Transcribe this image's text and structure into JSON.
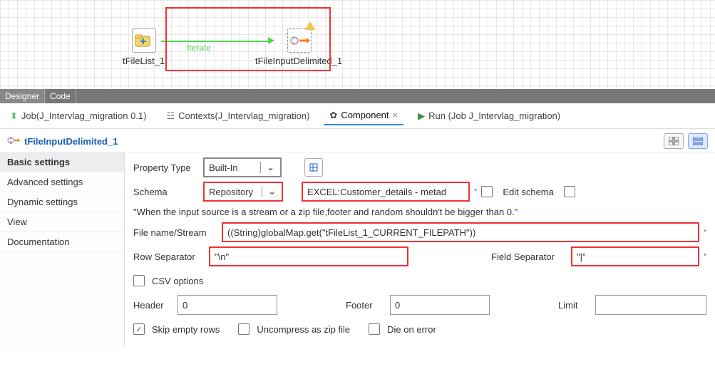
{
  "canvas": {
    "nodes": {
      "filelist": {
        "label": "tFileList_1"
      },
      "fileinput": {
        "label": "tFileInputDelimited_1"
      }
    },
    "edge_label": "Iterate"
  },
  "bottom_tabs": {
    "designer": "Designer",
    "code": "Code"
  },
  "view_tabs": {
    "job": "Job(J_Intervlag_migration 0.1)",
    "contexts": "Contexts(J_Intervlag_migration)",
    "component": "Component",
    "run": "Run (Job J_Intervlag_migration)"
  },
  "component_title": "tFileInputDelimited_1",
  "sidebar": {
    "basic": "Basic settings",
    "advanced": "Advanced settings",
    "dynamic": "Dynamic settings",
    "view": "View",
    "documentation": "Documentation"
  },
  "form": {
    "property_type_label": "Property Type",
    "property_type_value": "Built-In",
    "schema_label": "Schema",
    "schema_value": "Repository",
    "schema_repo_value": "EXCEL:Customer_details - metad",
    "edit_schema": "Edit schema",
    "note": "\"When the input source is a stream or a zip file,footer and random shouldn't be bigger than 0.\"",
    "filename_label": "File name/Stream",
    "filename_value": "((String)globalMap.get(\"tFileList_1_CURRENT_FILEPATH\"))",
    "row_sep_label": "Row Separator",
    "row_sep_value": "\"\\n\"",
    "field_sep_label": "Field Separator",
    "field_sep_value": "\"|\"",
    "csv_options": "CSV options",
    "header_label": "Header",
    "header_value": "0",
    "footer_label": "Footer",
    "footer_value": "0",
    "limit_label": "Limit",
    "limit_value": "",
    "skip_empty": "Skip empty rows",
    "uncompress": "Uncompress as zip file",
    "die_on_error": "Die on error"
  }
}
